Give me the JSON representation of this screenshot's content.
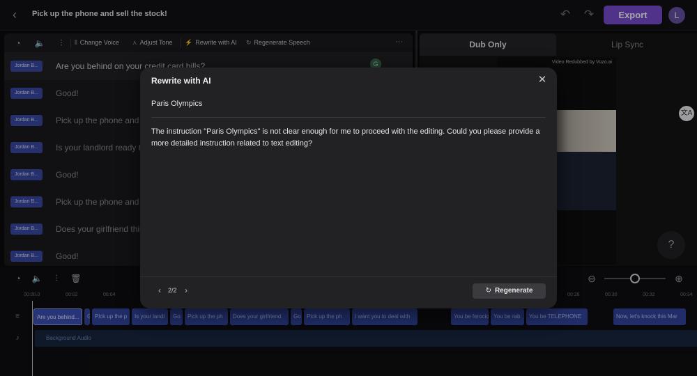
{
  "header": {
    "title": "Pick up the phone and sell the stock!",
    "export_label": "Export",
    "avatar_initial": "L"
  },
  "toolbar": {
    "change_voice": "Change Voice",
    "adjust_tone": "Adjust Tone",
    "rewrite_ai": "Rewrite with AI",
    "regenerate_speech": "Regenerate Speech",
    "more": "···"
  },
  "transcript": {
    "rows": [
      {
        "speaker": "Jordan B...",
        "text": "Are you behind on your credit card bills?"
      },
      {
        "speaker": "Jordan B...",
        "text": "Good!"
      },
      {
        "speaker": "Jordan B...",
        "text": "Pick up the phone and s"
      },
      {
        "speaker": "Jordan B...",
        "text": "Is your landlord ready to"
      },
      {
        "speaker": "Jordan B...",
        "text": "Good!"
      },
      {
        "speaker": "Jordan B...",
        "text": "Pick up the phone and s"
      },
      {
        "speaker": "Jordan B...",
        "text": "Does your girlfriend thin"
      },
      {
        "speaker": "Jordan B...",
        "text": "Good!"
      }
    ]
  },
  "preview": {
    "tab_dub": "Dub Only",
    "tab_lip": "Lip Sync",
    "video_label": "Video Redubbed by Vozo.ai"
  },
  "timeline": {
    "ticks": [
      "00:00.0",
      "00:02",
      "00:04",
      "00:28",
      "00:30",
      "00:32",
      "00:34"
    ],
    "clips": [
      {
        "text": "Are you behind..."
      },
      {
        "text": "G"
      },
      {
        "text": "Pick up the p"
      },
      {
        "text": "Is your landl"
      },
      {
        "text": "Go"
      },
      {
        "text": "Pick up the ph"
      },
      {
        "text": "Does your girlfriend"
      },
      {
        "text": "Go"
      },
      {
        "text": "Pick up the ph"
      },
      {
        "text": "I want you to deal with"
      },
      {
        "text": "You be ferocio"
      },
      {
        "text": "You be rab"
      },
      {
        "text": "You be TELEPHONE"
      },
      {
        "text": "Now, let's knock this Mar"
      }
    ],
    "background_audio": "Background Audio"
  },
  "modal": {
    "title": "Rewrite with AI",
    "instruction": "Paris Olympics",
    "response": "The instruction \"Paris Olympics\" is not clear enough for me to proceed with the editing. Could you please provide a more detailed instruction related to text editing?",
    "page_count": "2/2",
    "regenerate_label": "Regenerate"
  },
  "help_label": "?"
}
